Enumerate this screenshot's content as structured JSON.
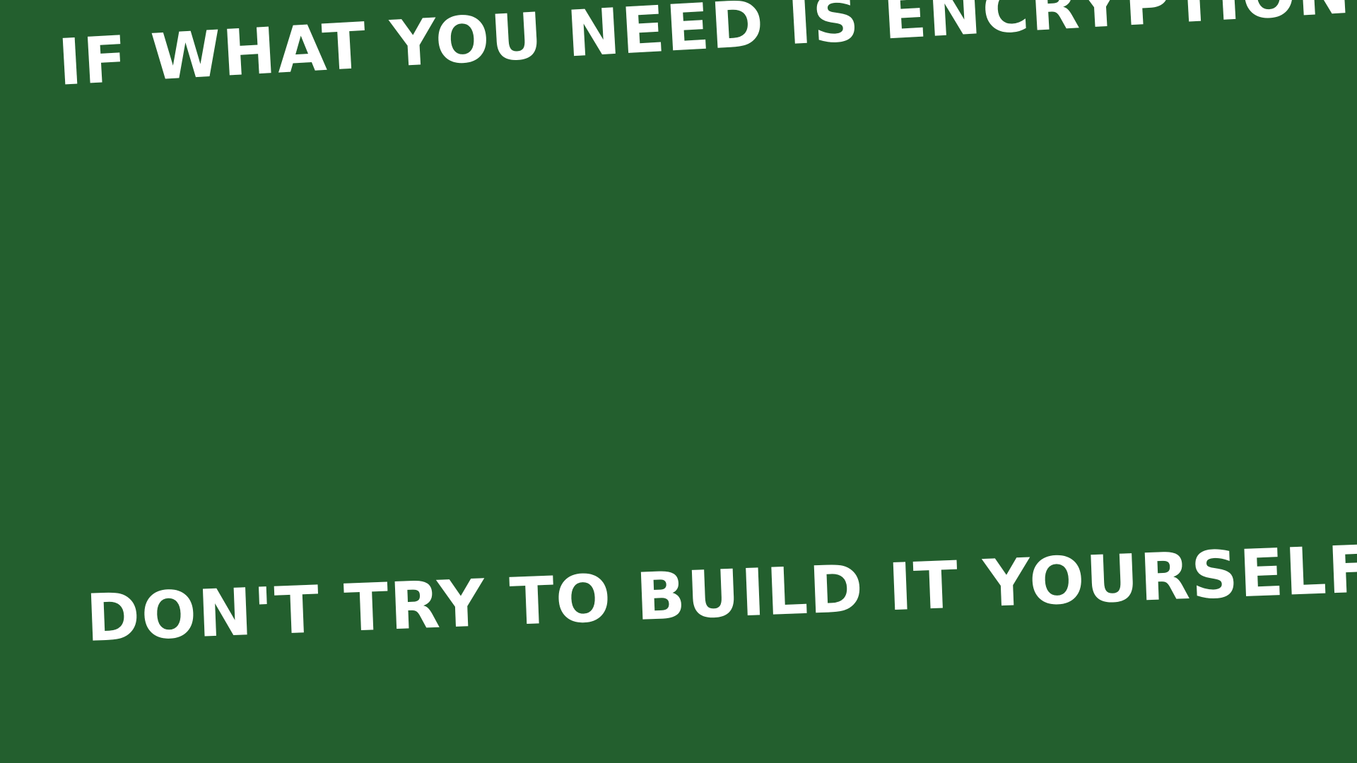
{
  "slide": {
    "background_color": "#235f2e",
    "text_color": "#ffffff",
    "top_line": "If what you need is Encryption",
    "bottom_line": "Don't try to build it yourself."
  }
}
